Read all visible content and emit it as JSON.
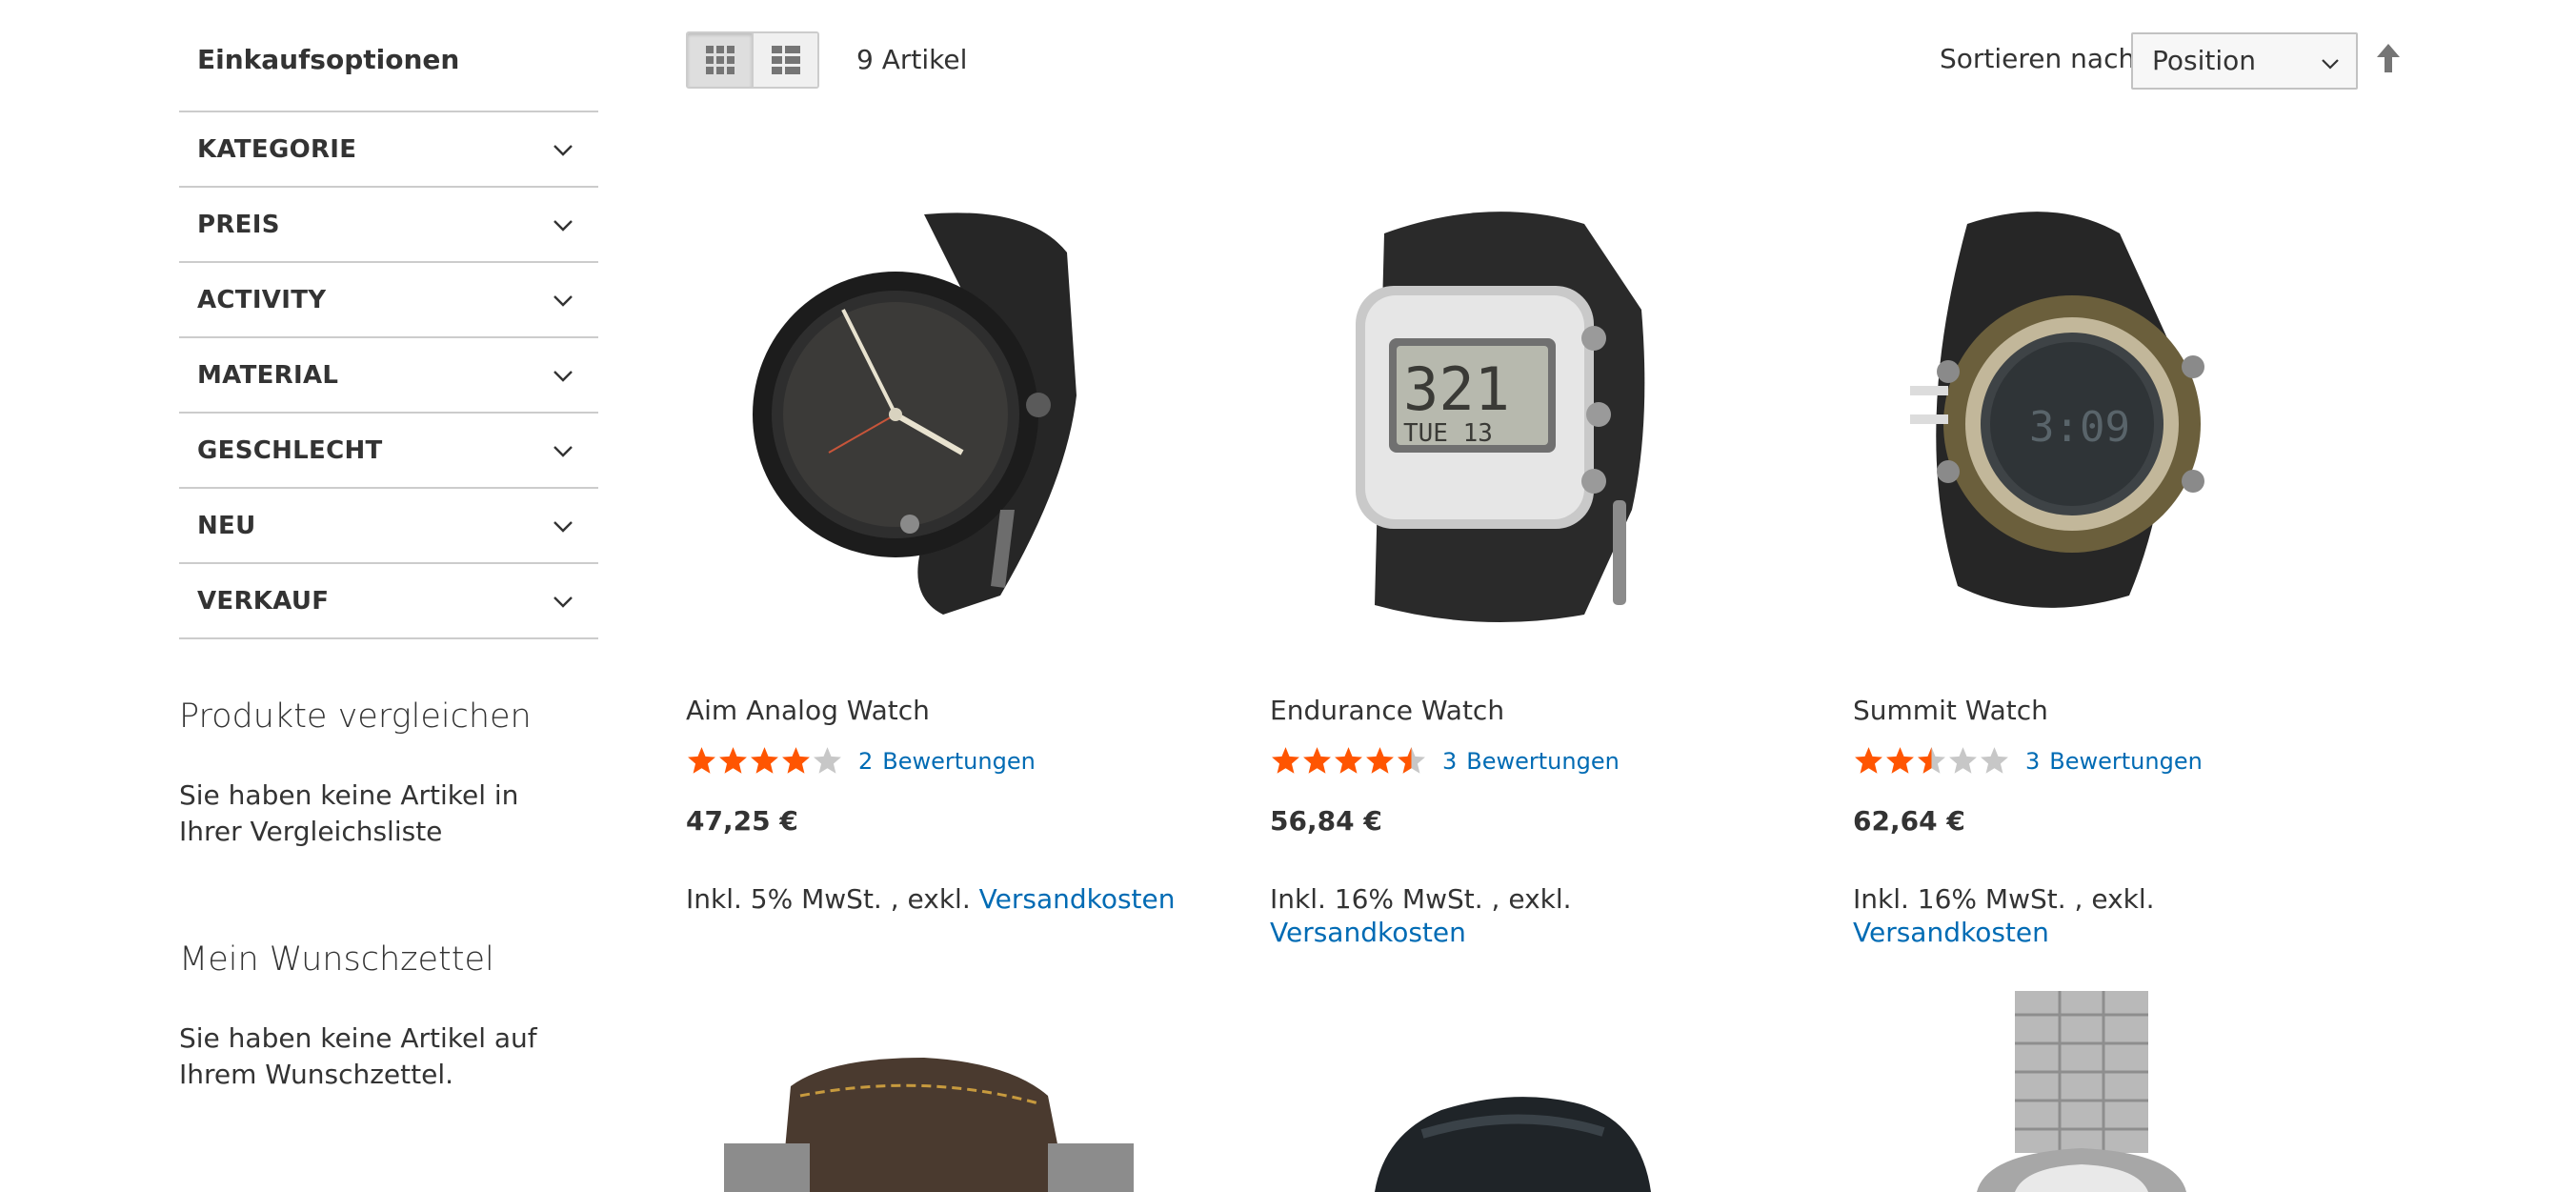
{
  "sidebar": {
    "title": "Einkaufsoptionen",
    "filters": [
      {
        "label": "KATEGORIE"
      },
      {
        "label": "PREIS"
      },
      {
        "label": "ACTIVITY"
      },
      {
        "label": "MATERIAL"
      },
      {
        "label": "GESCHLECHT"
      },
      {
        "label": "NEU"
      },
      {
        "label": "VERKAUF"
      }
    ],
    "compare": {
      "title": "Produkte vergleichen",
      "text": "Sie haben keine Artikel in Ihrer Vergleichsliste"
    },
    "wishlist": {
      "title": "Mein Wunschzettel",
      "text": "Sie haben keine Artikel auf Ihrem Wunschzettel."
    }
  },
  "toolbar": {
    "view_modes": [
      {
        "icon": "grid-icon",
        "active": true
      },
      {
        "icon": "list-icon",
        "active": false
      }
    ],
    "count_text": "9 Artikel",
    "sort_label": "Sortieren nach",
    "sort_value": "Position",
    "sort_direction_icon": "arrow-up-icon"
  },
  "products": [
    {
      "name": "Aim Analog Watch",
      "rating_stars": 4,
      "review_count": "2",
      "review_word": "Bewertungen",
      "price": "47,25 €",
      "tax_text": "Inkl. 5% MwSt. , exkl.",
      "shipping_link": "Versandkosten"
    },
    {
      "name": "Endurance Watch",
      "rating_stars": 4.5,
      "review_count": "3",
      "review_word": "Bewertungen",
      "price": "56,84 €",
      "tax_text": "Inkl. 16% MwSt. , exkl.",
      "shipping_link": "Versandkosten"
    },
    {
      "name": "Summit Watch",
      "rating_stars": 2.5,
      "review_count": "3",
      "review_word": "Bewertungen",
      "price": "62,64 €",
      "tax_text": "Inkl. 16% MwSt. , exkl.",
      "shipping_link": "Versandkosten"
    }
  ],
  "colors": {
    "accent_link": "#006bb4",
    "star_filled": "#ff5501",
    "star_empty": "#c7c7c7",
    "border": "#cccccc"
  }
}
